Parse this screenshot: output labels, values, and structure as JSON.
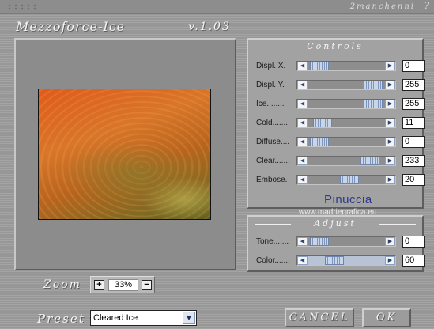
{
  "app": {
    "title": "Mezzoforce-Ice",
    "version": "v.1.03",
    "author_credit": "2manchenni",
    "help_glyph": "?"
  },
  "controls_panel": {
    "title": "Controls",
    "sliders": [
      {
        "label": "Displ. X.",
        "value": "0",
        "level": 0.04
      },
      {
        "label": "Displ. Y.",
        "value": "255",
        "level": 0.96
      },
      {
        "label": "Ice........",
        "value": "255",
        "level": 0.96
      },
      {
        "label": "Cold.......",
        "value": "11",
        "level": 0.09
      },
      {
        "label": "Diffuse....",
        "value": "0",
        "level": 0.04
      },
      {
        "label": "Clear.......",
        "value": "233",
        "level": 0.9
      },
      {
        "label": "Embose.",
        "value": "20",
        "level": 0.55
      }
    ]
  },
  "adjust_panel": {
    "title": "Adjust",
    "sliders": [
      {
        "label": "Tone.......",
        "value": "0",
        "level": 0.04
      },
      {
        "label": "Color.......",
        "value": "60",
        "level": 0.3
      }
    ]
  },
  "watermark": {
    "name": "Pinuccia",
    "url": "www.madriegrafica.eu"
  },
  "zoom": {
    "label": "Zoom",
    "value": "33%",
    "plus": "+",
    "minus": "−"
  },
  "preset": {
    "label": "Preset",
    "value": "Cleared Ice"
  },
  "buttons": {
    "cancel": "CANCEL",
    "ok": "OK"
  },
  "colors": {
    "accent": "#8aa0c0",
    "watermark": "#2b3a8a"
  }
}
